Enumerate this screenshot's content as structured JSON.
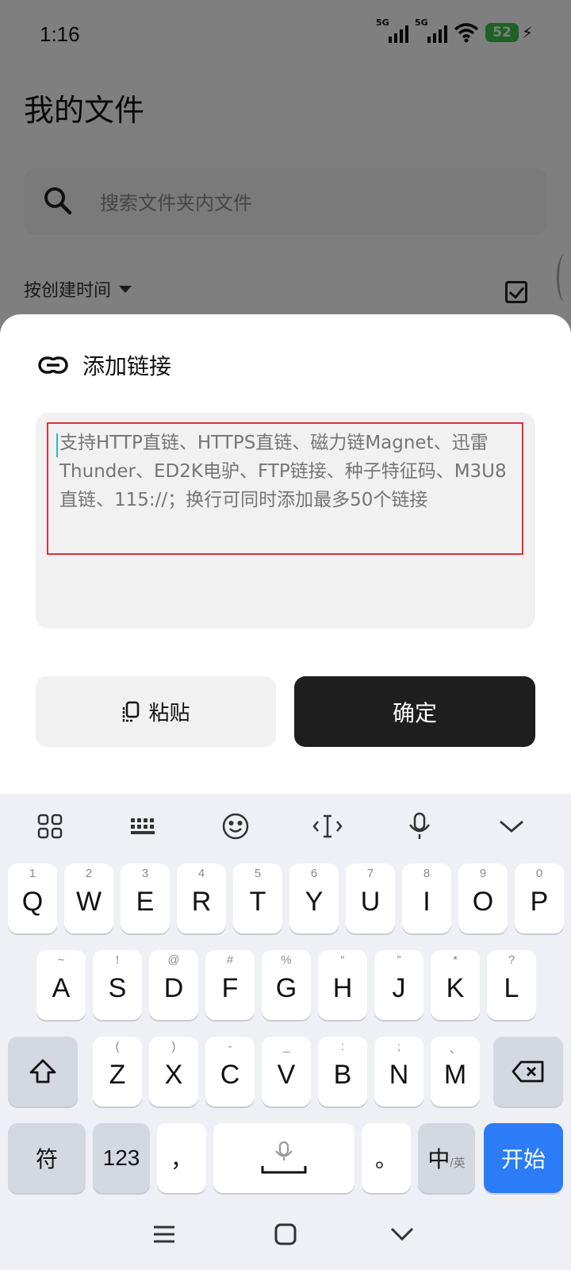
{
  "status_bar": {
    "time": "1:16",
    "sim1_label": "5G",
    "sim2_label": "5G",
    "battery": "52"
  },
  "page": {
    "title": "我的文件",
    "search_placeholder": "搜索文件夹内文件",
    "sort_label": "按创建时间"
  },
  "sheet": {
    "title": "添加链接",
    "input_placeholder": "支持HTTP直链、HTTPS直链、磁力链Magnet、迅雷Thunder、ED2K电驴、FTP链接、种子特征码、M3U8直链、115://；换行可同时添加最多50个链接",
    "paste_label": "粘贴",
    "confirm_label": "确定"
  },
  "keyboard": {
    "row1": [
      {
        "hint": "1",
        "key": "Q"
      },
      {
        "hint": "2",
        "key": "W"
      },
      {
        "hint": "3",
        "key": "E"
      },
      {
        "hint": "4",
        "key": "R"
      },
      {
        "hint": "5",
        "key": "T"
      },
      {
        "hint": "6",
        "key": "Y"
      },
      {
        "hint": "7",
        "key": "U"
      },
      {
        "hint": "8",
        "key": "I"
      },
      {
        "hint": "9",
        "key": "O"
      },
      {
        "hint": "0",
        "key": "P"
      }
    ],
    "row2": [
      {
        "hint": "~",
        "key": "A"
      },
      {
        "hint": "!",
        "key": "S"
      },
      {
        "hint": "@",
        "key": "D"
      },
      {
        "hint": "#",
        "key": "F"
      },
      {
        "hint": "%",
        "key": "G"
      },
      {
        "hint": "“",
        "key": "H"
      },
      {
        "hint": "”",
        "key": "J"
      },
      {
        "hint": "*",
        "key": "K"
      },
      {
        "hint": "?",
        "key": "L"
      }
    ],
    "row3": [
      {
        "hint": "(",
        "key": "Z"
      },
      {
        "hint": ")",
        "key": "X"
      },
      {
        "hint": "-",
        "key": "C"
      },
      {
        "hint": "_",
        "key": "V"
      },
      {
        "hint": ":",
        "key": "B"
      },
      {
        "hint": ";",
        "key": "N"
      },
      {
        "hint": "、",
        "key": "M"
      }
    ],
    "symbols_key": "符",
    "numbers_key": "123",
    "comma_key": "，",
    "period_key": "。",
    "lang_key_main": "中",
    "lang_key_sub": "/英",
    "go_key": "开始"
  },
  "colors": {
    "accent": "#2b7cf6",
    "highlight_border": "#e03030",
    "battery": "#3cc04c"
  }
}
